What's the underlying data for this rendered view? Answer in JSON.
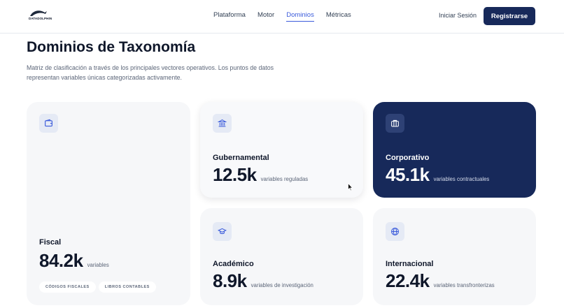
{
  "brand": {
    "name": "DATADOLPHIN"
  },
  "nav": {
    "items": [
      "Plataforma",
      "Motor",
      "Dominios",
      "Métricas"
    ],
    "active_index": 2
  },
  "auth": {
    "login_label": "Iniciar Sesión",
    "register_label": "Registrarse"
  },
  "page": {
    "title": "Dominios de Taxonomía",
    "description": "Matriz de clasificación a través de los principales vectores operativos. Los puntos de datos representan variables únicas categorizadas activamente."
  },
  "cards": [
    {
      "id": "fiscal",
      "icon": "wallet-icon",
      "title": "Fiscal",
      "value": "84.2k",
      "unit": "variables",
      "tags": [
        "CÓDIGOS FISCALES",
        "LIBROS CONTABLES"
      ]
    },
    {
      "id": "gubernamental",
      "icon": "bank-icon",
      "title": "Gubernamental",
      "value": "12.5k",
      "unit": "variables reguladas"
    },
    {
      "id": "corporativo",
      "icon": "briefcase-icon",
      "title": "Corporativo",
      "value": "45.1k",
      "unit": "variables contractuales"
    },
    {
      "id": "academico",
      "icon": "graduation-cap-icon",
      "title": "Académico",
      "value": "8.9k",
      "unit": "variables de investigación"
    },
    {
      "id": "internacional",
      "icon": "globe-icon",
      "title": "Internacional",
      "value": "22.4k",
      "unit": "variables transfronterizas"
    }
  ],
  "colors": {
    "primary": "#17295a",
    "accent": "#3b5bdb",
    "card_bg": "#f6f7f9",
    "icon_bg": "#e5eaf5"
  }
}
